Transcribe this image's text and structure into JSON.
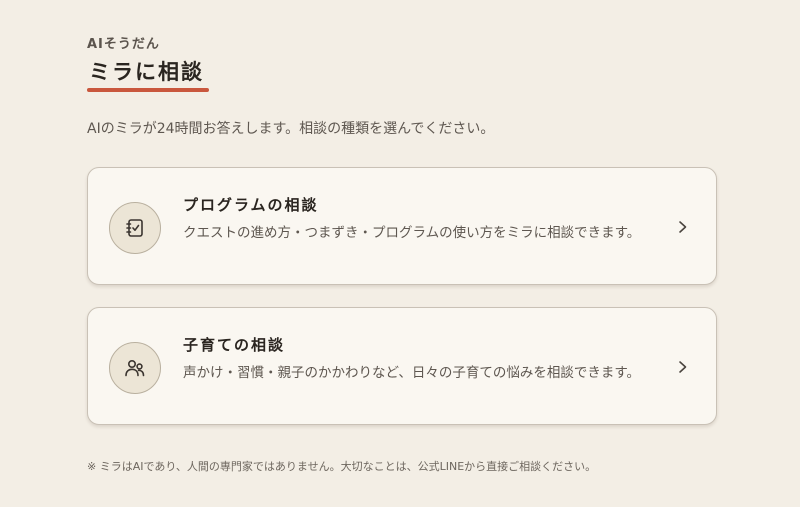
{
  "header": {
    "eyebrow": "AIそうだん",
    "title": "ミラに相談",
    "lead": "AIのミラが24時間お答えします。相談の種類を選んでください。"
  },
  "cards": [
    {
      "icon": "checklist-notebook-icon",
      "title": "プログラムの相談",
      "description": "クエストの進め方・つまずき・プログラムの使い方をミラに相談できます。"
    },
    {
      "icon": "parent-child-icon",
      "title": "子育ての相談",
      "description": "声かけ・習慣・親子のかかわりなど、日々の子育ての悩みを相談できます。"
    }
  ],
  "footnote": "※ ミラはAIであり、人間の専門家ではありません。大切なことは、公式LINEから直接ご相談ください。",
  "colors": {
    "background": "#f3eee5",
    "card_background": "#faf7f1",
    "accent_underline": "#c9573d",
    "heading_text": "#2a2520",
    "body_text": "#5e5750"
  }
}
